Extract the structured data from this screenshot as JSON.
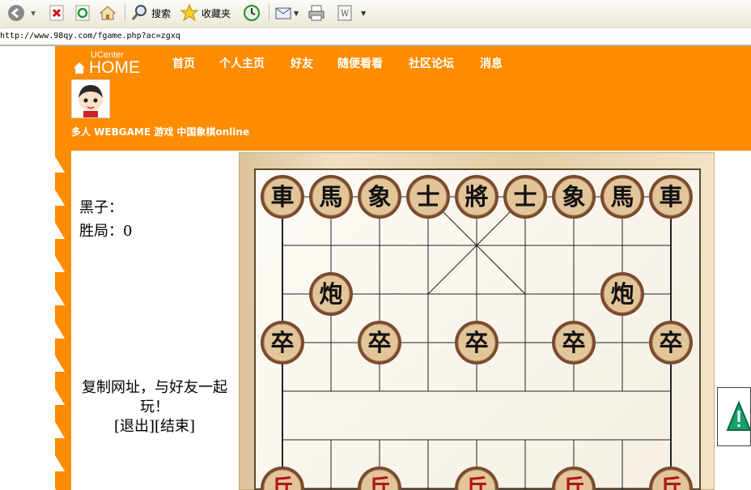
{
  "browser": {
    "toolbar": {
      "search_label": "搜索",
      "favorites_label": "收藏夹"
    },
    "address": "http://www.98qy.com/fgame.php?ac=zgxq"
  },
  "site": {
    "logo_top": "UCenter",
    "logo_main": "HOME",
    "nav": [
      "首页",
      "个人主页",
      "好友",
      "随便看看",
      "社区论坛",
      "消息"
    ],
    "breadcrumb": "多人  WEBGAME 游戏  中国象棋online"
  },
  "game": {
    "black_label": "黑子：",
    "wins_label": "胜局：",
    "wins_value": "0",
    "share_text": "复制网址，与好友一起玩！",
    "quit_link": "[退出]",
    "end_link": "[结束]"
  },
  "board": {
    "black_pieces": [
      {
        "char": "車",
        "col": 0,
        "row": 0
      },
      {
        "char": "馬",
        "col": 1,
        "row": 0
      },
      {
        "char": "象",
        "col": 2,
        "row": 0
      },
      {
        "char": "士",
        "col": 3,
        "row": 0
      },
      {
        "char": "將",
        "col": 4,
        "row": 0
      },
      {
        "char": "士",
        "col": 5,
        "row": 0
      },
      {
        "char": "象",
        "col": 6,
        "row": 0
      },
      {
        "char": "馬",
        "col": 7,
        "row": 0
      },
      {
        "char": "車",
        "col": 8,
        "row": 0
      },
      {
        "char": "炮",
        "col": 1,
        "row": 2
      },
      {
        "char": "炮",
        "col": 7,
        "row": 2
      },
      {
        "char": "卒",
        "col": 0,
        "row": 3
      },
      {
        "char": "卒",
        "col": 2,
        "row": 3
      },
      {
        "char": "卒",
        "col": 4,
        "row": 3
      },
      {
        "char": "卒",
        "col": 6,
        "row": 3
      },
      {
        "char": "卒",
        "col": 8,
        "row": 3
      }
    ],
    "red_pieces": [
      {
        "char": "兵",
        "col": 0,
        "row": 6
      },
      {
        "char": "兵",
        "col": 2,
        "row": 6
      },
      {
        "char": "兵",
        "col": 4,
        "row": 6
      },
      {
        "char": "兵",
        "col": 6,
        "row": 6
      },
      {
        "char": "兵",
        "col": 8,
        "row": 6
      }
    ],
    "colors": {
      "piece_fill": "#e3c59a",
      "piece_ring": "#7a4a2e",
      "black_text": "#111111",
      "red_text": "#b01818",
      "line": "#222222"
    }
  },
  "colors": {
    "brand_orange": "#fe8c00"
  }
}
